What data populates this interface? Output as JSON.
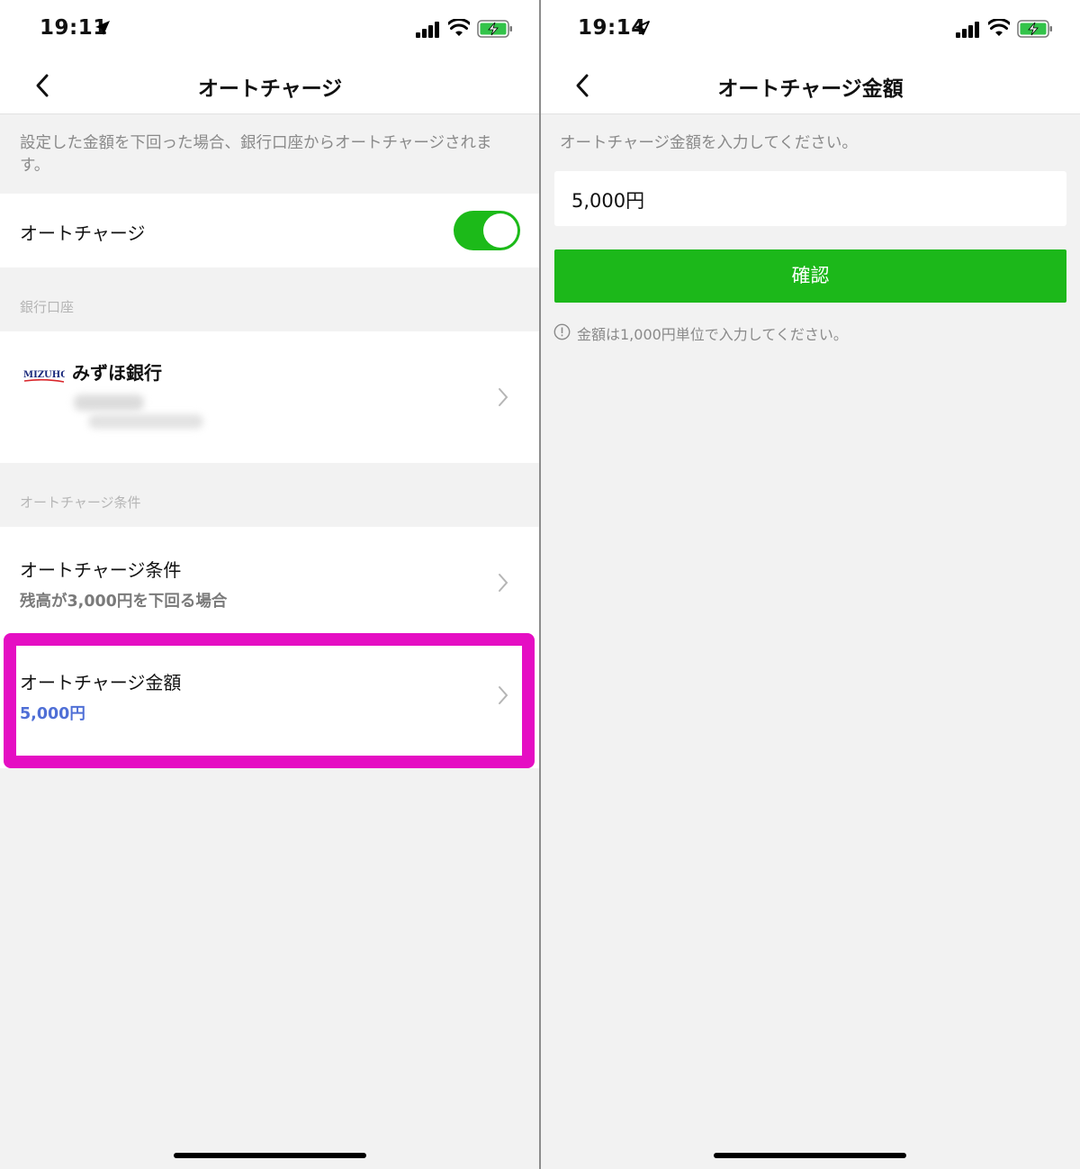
{
  "left": {
    "status": {
      "time": "19:11"
    },
    "nav": {
      "title": "オートチャージ"
    },
    "description": "設定した金額を下回った場合、銀行口座からオートチャージされます。",
    "autocharge_toggle": {
      "label": "オートチャージ",
      "on": true,
      "color": "#1cba19"
    },
    "bank_section": {
      "header": "銀行口座",
      "logo_text": "MIZUHO",
      "bank_name": "みずほ銀行"
    },
    "conditions_section": {
      "header": "オートチャージ条件",
      "condition_row": {
        "label": "オートチャージ条件",
        "value": "残高が3,000円を下回る場合"
      },
      "amount_row": {
        "label": "オートチャージ金額",
        "value": "5,000円",
        "value_color": "#4f6fd6"
      }
    },
    "highlight_color": "#e50ec3"
  },
  "right": {
    "status": {
      "time": "19:14"
    },
    "nav": {
      "title": "オートチャージ金額"
    },
    "description": "オートチャージ金額を入力してください。",
    "amount_input": {
      "value": "5,000円"
    },
    "confirm_button": {
      "label": "確認",
      "color": "#1cb81a"
    },
    "note": "金額は1,000円単位で入力してください。"
  }
}
